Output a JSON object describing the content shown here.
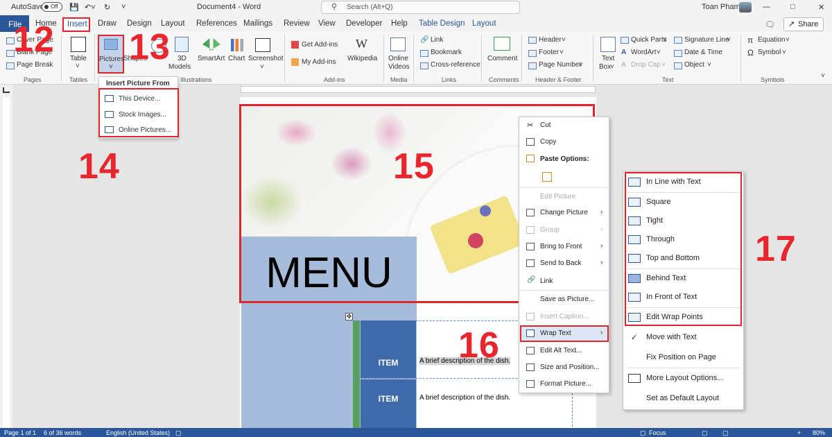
{
  "title_bar": {
    "autosave": "AutoSave",
    "autosave_state": "Off",
    "document": "Document4 - Word",
    "search_placeholder": "Search (Alt+Q)",
    "user": "Toan Pham"
  },
  "tabs": [
    "File",
    "Home",
    "Insert",
    "Draw",
    "Design",
    "Layout",
    "References",
    "Mailings",
    "Review",
    "View",
    "Developer",
    "Help",
    "Table Design",
    "Layout"
  ],
  "share": "Share",
  "ribbon": {
    "pages": {
      "items": [
        "Cover Page",
        "Blank Page",
        "Page Break"
      ],
      "label": "Pages"
    },
    "tables": {
      "table": "Table",
      "label": "Tables"
    },
    "illustrations": {
      "pictures": "Pictures",
      "shapes": "Shapes",
      "icons": "Icons",
      "models": "3D",
      "models2": "Models",
      "smartart": "SmartArt",
      "chart": "Chart",
      "screenshot": "Screenshot",
      "label": "Illustrations"
    },
    "addins": {
      "get": "Get Add-ins",
      "my": "My Add-ins",
      "wikipedia": "Wikipedia",
      "label": "Add-ins"
    },
    "media": {
      "online": "Online",
      "videos": "Videos",
      "label": "Media"
    },
    "links": {
      "link": "Link",
      "bookmark": "Bookmark",
      "cross": "Cross-reference",
      "label": "Links"
    },
    "comments": {
      "comment": "Comment",
      "label": "Comments"
    },
    "hf": {
      "header": "Header",
      "footer": "Footer",
      "pagenum": "Page Number",
      "label": "Header & Footer"
    },
    "text": {
      "textbox": "Text",
      "textbox2": "Box",
      "quickparts": "Quick Parts",
      "wordart": "WordArt",
      "dropcap": "Drop Cap",
      "sig": "Signature Line",
      "datetime": "Date & Time",
      "object": "Object",
      "label": "Text"
    },
    "symbols": {
      "equation": "Equation",
      "symbol": "Symbol",
      "label": "Symbols"
    }
  },
  "picture_menu": {
    "header": "Insert Picture From",
    "items": [
      "This Device...",
      "Stock Images...",
      "Online Pictures..."
    ]
  },
  "document": {
    "menu_title": "MENU",
    "rows": [
      {
        "item": "ITEM",
        "desc": "A brief description of the dish."
      },
      {
        "item": "ITEM",
        "desc": "A brief description of the dish."
      }
    ]
  },
  "context_menu": {
    "cut": "Cut",
    "copy": "Copy",
    "paste_options": "Paste Options:",
    "edit_picture": "Edit Picture",
    "change_picture": "Change Picture",
    "group": "Group",
    "bring_front": "Bring to Front",
    "send_back": "Send to Back",
    "link": "Link",
    "save_as": "Save as Picture...",
    "insert_caption": "Insert Caption...",
    "wrap_text": "Wrap Text",
    "edit_alt": "Edit Alt Text...",
    "size_pos": "Size and Position...",
    "format_pic": "Format Picture..."
  },
  "wrap_menu": {
    "items": [
      "In Line with Text",
      "Square",
      "Tight",
      "Through",
      "Top and Bottom",
      "Behind Text",
      "In Front of Text",
      "Edit Wrap Points"
    ],
    "move": "Move with Text",
    "fix": "Fix Position on Page",
    "more": "More Layout Options...",
    "default": "Set as Default Layout"
  },
  "annotations": {
    "n12": "12",
    "n13": "13",
    "n14": "14",
    "n15": "15",
    "n16": "16",
    "n17": "17"
  },
  "status": {
    "page": "Page 1 of 1",
    "words": "6 of 36 words",
    "lang": "English (United States)",
    "focus": "Focus",
    "zoom": "80%"
  }
}
